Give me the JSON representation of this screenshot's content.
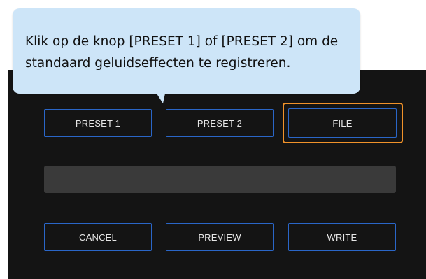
{
  "callout": {
    "text": "Klik op de knop [PRESET 1] of [PRESET 2] om de standaard geluidseffecten te registreren."
  },
  "buttons": {
    "preset1": "PRESET 1",
    "preset2": "PRESET 2",
    "file": "FILE",
    "cancel": "CANCEL",
    "preview": "PREVIEW",
    "write": "WRITE"
  },
  "progress": {
    "value": 0
  },
  "colors": {
    "panel_background": "#141414",
    "button_border": "#2a66c8",
    "highlight": "#f0922a",
    "callout_background": "#cde5f8",
    "progress_track": "#3a3a3a"
  }
}
